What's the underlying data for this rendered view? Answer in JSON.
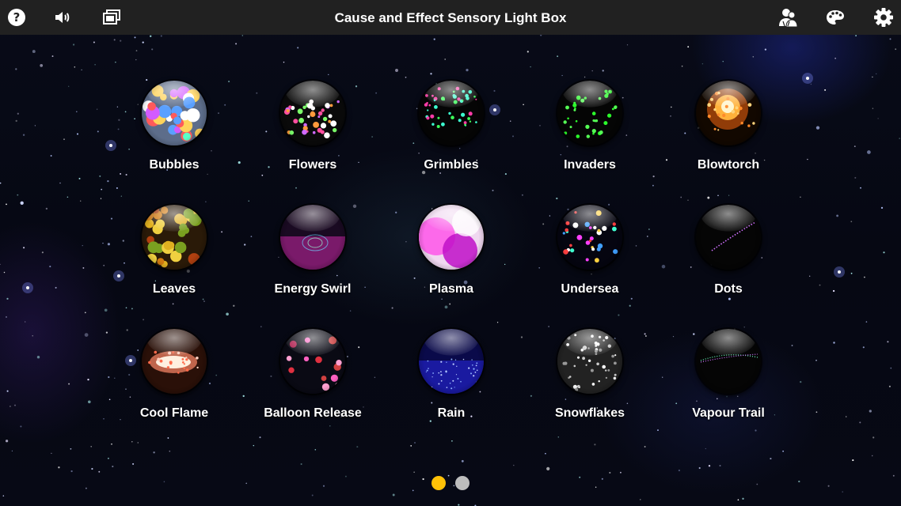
{
  "app": {
    "title": "Cause and Effect Sensory Light Box"
  },
  "toolbar": {
    "left": [
      {
        "icon": "help-icon"
      },
      {
        "icon": "volume-icon"
      },
      {
        "icon": "slideshow-icon"
      }
    ],
    "right": [
      {
        "icon": "users-icon"
      },
      {
        "icon": "palette-icon"
      },
      {
        "icon": "settings-gear-icon"
      }
    ]
  },
  "effects": [
    {
      "label": "Bubbles",
      "icon": "bubbles-icon"
    },
    {
      "label": "Flowers",
      "icon": "flowers-icon"
    },
    {
      "label": "Grimbles",
      "icon": "grimbles-icon"
    },
    {
      "label": "Invaders",
      "icon": "invaders-icon"
    },
    {
      "label": "Blowtorch",
      "icon": "blowtorch-icon"
    },
    {
      "label": "Leaves",
      "icon": "leaves-icon"
    },
    {
      "label": "Energy Swirl",
      "icon": "energy-swirl-icon"
    },
    {
      "label": "Plasma",
      "icon": "plasma-icon"
    },
    {
      "label": "Undersea",
      "icon": "undersea-icon"
    },
    {
      "label": "Dots",
      "icon": "dots-icon"
    },
    {
      "label": "Cool Flame",
      "icon": "cool-flame-icon"
    },
    {
      "label": "Balloon Release",
      "icon": "balloon-release-icon"
    },
    {
      "label": "Rain",
      "icon": "rain-icon"
    },
    {
      "label": "Snowflakes",
      "icon": "snowflakes-icon"
    },
    {
      "label": "Vapour Trail",
      "icon": "vapour-trail-icon"
    }
  ],
  "pager": {
    "pages": 2,
    "current": 1,
    "active_color": "#ffc107",
    "inactive_color": "#bdbdbd"
  },
  "colors": {
    "toolbar_bg": "#212121",
    "background": "#05070f",
    "text": "#ffffff"
  }
}
